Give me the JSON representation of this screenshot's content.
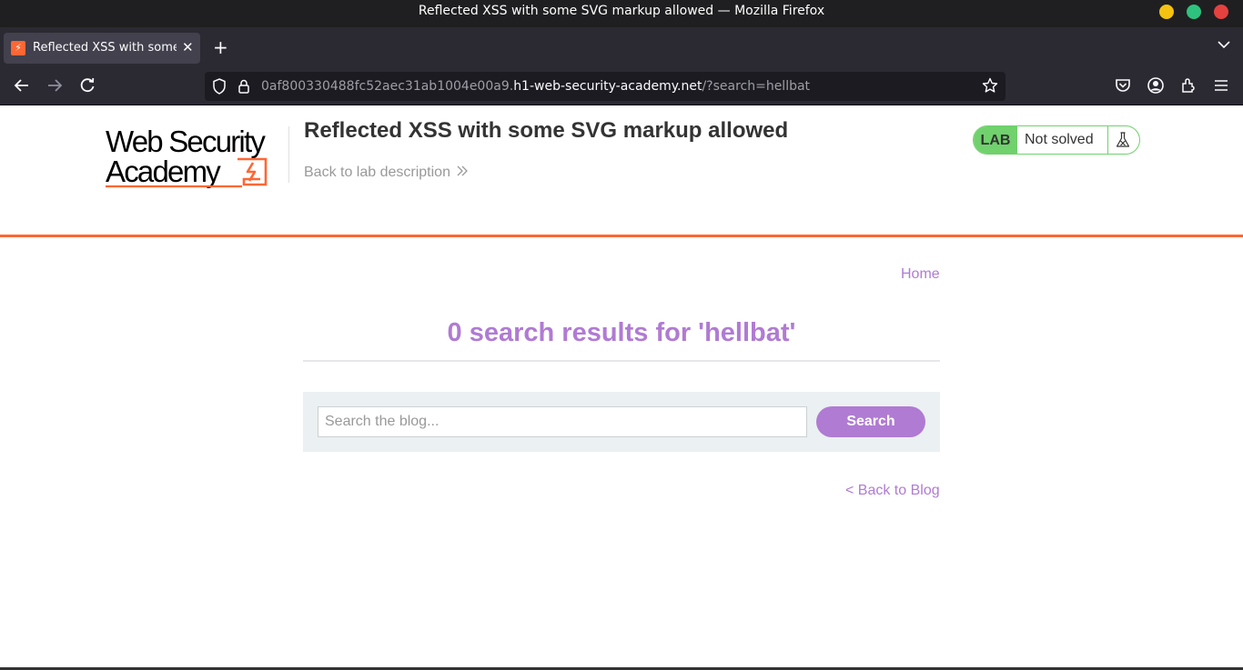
{
  "window": {
    "title": "Reflected XSS with some SVG markup allowed — Mozilla Firefox"
  },
  "browser": {
    "tab_title": "Reflected XSS with some SVG markup allowed",
    "url_prefix": "0af800330488fc52aec31ab1004e00a9.",
    "url_host": "h1-web-security-academy.net",
    "url_path": "/?search=hellbat"
  },
  "header": {
    "logo_line1": "Web Security",
    "logo_line2": "Academy",
    "lab_title": "Reflected XSS with some SVG markup allowed",
    "back_link": "Back to lab description",
    "status_badge": "LAB",
    "status_text": "Not solved"
  },
  "nav": {
    "home": "Home"
  },
  "main": {
    "results_heading": "0 search results for 'hellbat'",
    "search_placeholder": "Search the blog...",
    "search_button": "Search",
    "back_to_blog": "< Back to Blog"
  },
  "colors": {
    "brand_orange": "#ff6633",
    "accent_purple": "#b07bd3",
    "status_green": "#70d16d"
  },
  "icons": [
    "back-arrow-icon",
    "forward-arrow-icon",
    "reload-icon",
    "shield-icon",
    "lock-icon",
    "bookmark-star-icon",
    "pocket-icon",
    "account-icon",
    "extensions-icon",
    "menu-icon",
    "flask-icon",
    "double-chevron-icon"
  ]
}
